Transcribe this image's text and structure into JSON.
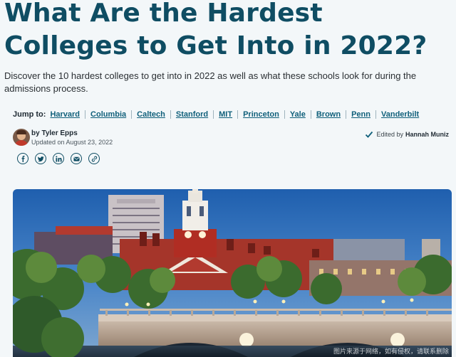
{
  "article": {
    "title": "What Are the Hardest Colleges to Get Into in 2022?",
    "description": "Discover the 10 hardest colleges to get into in 2022 as well as what these schools look for during the admissions process."
  },
  "jump": {
    "label": "Jump to:",
    "links": [
      "Harvard",
      "Columbia",
      "Caltech",
      "Stanford",
      "MIT",
      "Princeton",
      "Yale",
      "Brown",
      "Penn",
      "Vanderbilt"
    ]
  },
  "author": {
    "by": "by Tyler Epps",
    "updated": "Updated on August 23, 2022",
    "edited_prefix": "Edited by",
    "editor": "Hannah Muniz"
  },
  "social": [
    "facebook-icon",
    "twitter-icon",
    "linkedin-icon",
    "email-icon",
    "link-icon"
  ],
  "hero": {
    "watermark": "图片来源于网络，如有侵权，请联系删除"
  },
  "colors": {
    "title": "#0f4d63",
    "link": "#0f5f7a",
    "background": "#f3f7f9"
  }
}
